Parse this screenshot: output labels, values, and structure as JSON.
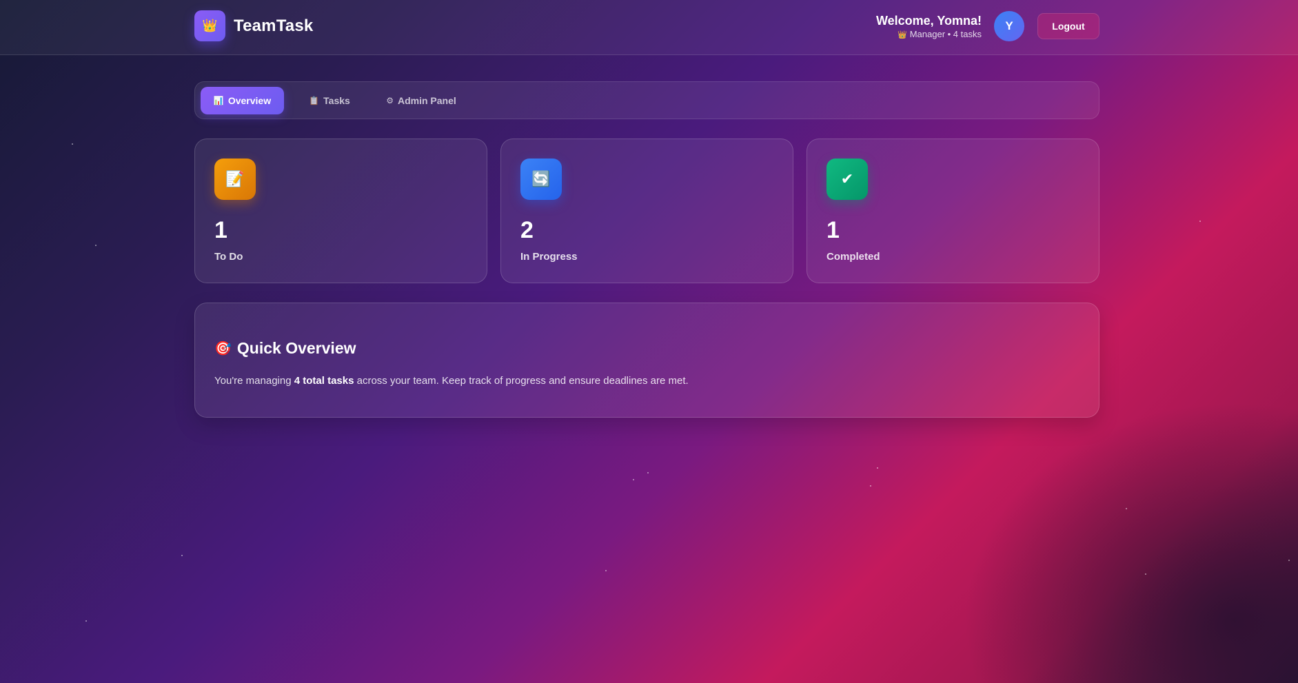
{
  "header": {
    "brand_icon": "👑",
    "brand_name": "TeamTask",
    "welcome": "Welcome, Yomna!",
    "role_icon": "👑",
    "role_line": "Manager • 4 tasks",
    "avatar_initial": "Y",
    "logout_label": "Logout"
  },
  "tabs": [
    {
      "icon": "📊",
      "label": "Overview",
      "active": true
    },
    {
      "icon": "📋",
      "label": "Tasks",
      "active": false
    },
    {
      "icon": "⚙",
      "label": "Admin Panel",
      "active": false
    }
  ],
  "stats": [
    {
      "icon": "📝",
      "value": "1",
      "label": "To Do",
      "color": "#f59e0b"
    },
    {
      "icon": "🔄",
      "value": "2",
      "label": "In Progress",
      "color": "#3b82f6"
    },
    {
      "icon": "✔",
      "value": "1",
      "label": "Completed",
      "color": "#10b981"
    }
  ],
  "overview": {
    "icon": "🎯",
    "title": "Quick Overview",
    "text_before": "You're managing ",
    "text_bold": "4 total tasks",
    "text_after": " across your team. Keep track of progress and ensure deadlines are met."
  },
  "colors": {
    "accent": "#8b5cf6",
    "logout_bg": "#dc266e"
  }
}
